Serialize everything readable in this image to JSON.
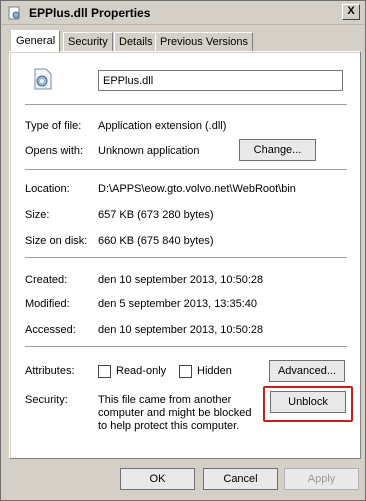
{
  "window": {
    "title": "EPPlus.dll Properties",
    "close_glyph": "X"
  },
  "tabs": [
    {
      "label": "General"
    },
    {
      "label": "Security"
    },
    {
      "label": "Details"
    },
    {
      "label": "Previous Versions"
    }
  ],
  "general": {
    "file_name": "EPPlus.dll",
    "type_label": "Type of file:",
    "type_value": "Application extension (.dll)",
    "opens_label": "Opens with:",
    "opens_value": "Unknown application",
    "change_button": "Change...",
    "location_label": "Location:",
    "location_value": "D:\\APPS\\eow.gto.volvo.net\\WebRoot\\bin",
    "size_label": "Size:",
    "size_value": "657 KB (673 280 bytes)",
    "size_on_disk_label": "Size on disk:",
    "size_on_disk_value": "660 KB (675 840 bytes)",
    "created_label": "Created:",
    "created_value": "den 10 september 2013, 10:50:28",
    "modified_label": "Modified:",
    "modified_value": "den 5 september 2013, 13:35:40",
    "accessed_label": "Accessed:",
    "accessed_value": "den 10 september 2013, 10:50:28",
    "attributes_label": "Attributes:",
    "readonly_label": "Read-only",
    "hidden_label": "Hidden",
    "advanced_button": "Advanced...",
    "security_label": "Security:",
    "security_text": "This file came from another computer and might be blocked to help protect this computer.",
    "unblock_button": "Unblock"
  },
  "footer": {
    "ok": "OK",
    "cancel": "Cancel",
    "apply": "Apply"
  },
  "colors": {
    "highlight": "#c82020",
    "panel": "#ffffff",
    "chrome": "#d4d0c8"
  }
}
